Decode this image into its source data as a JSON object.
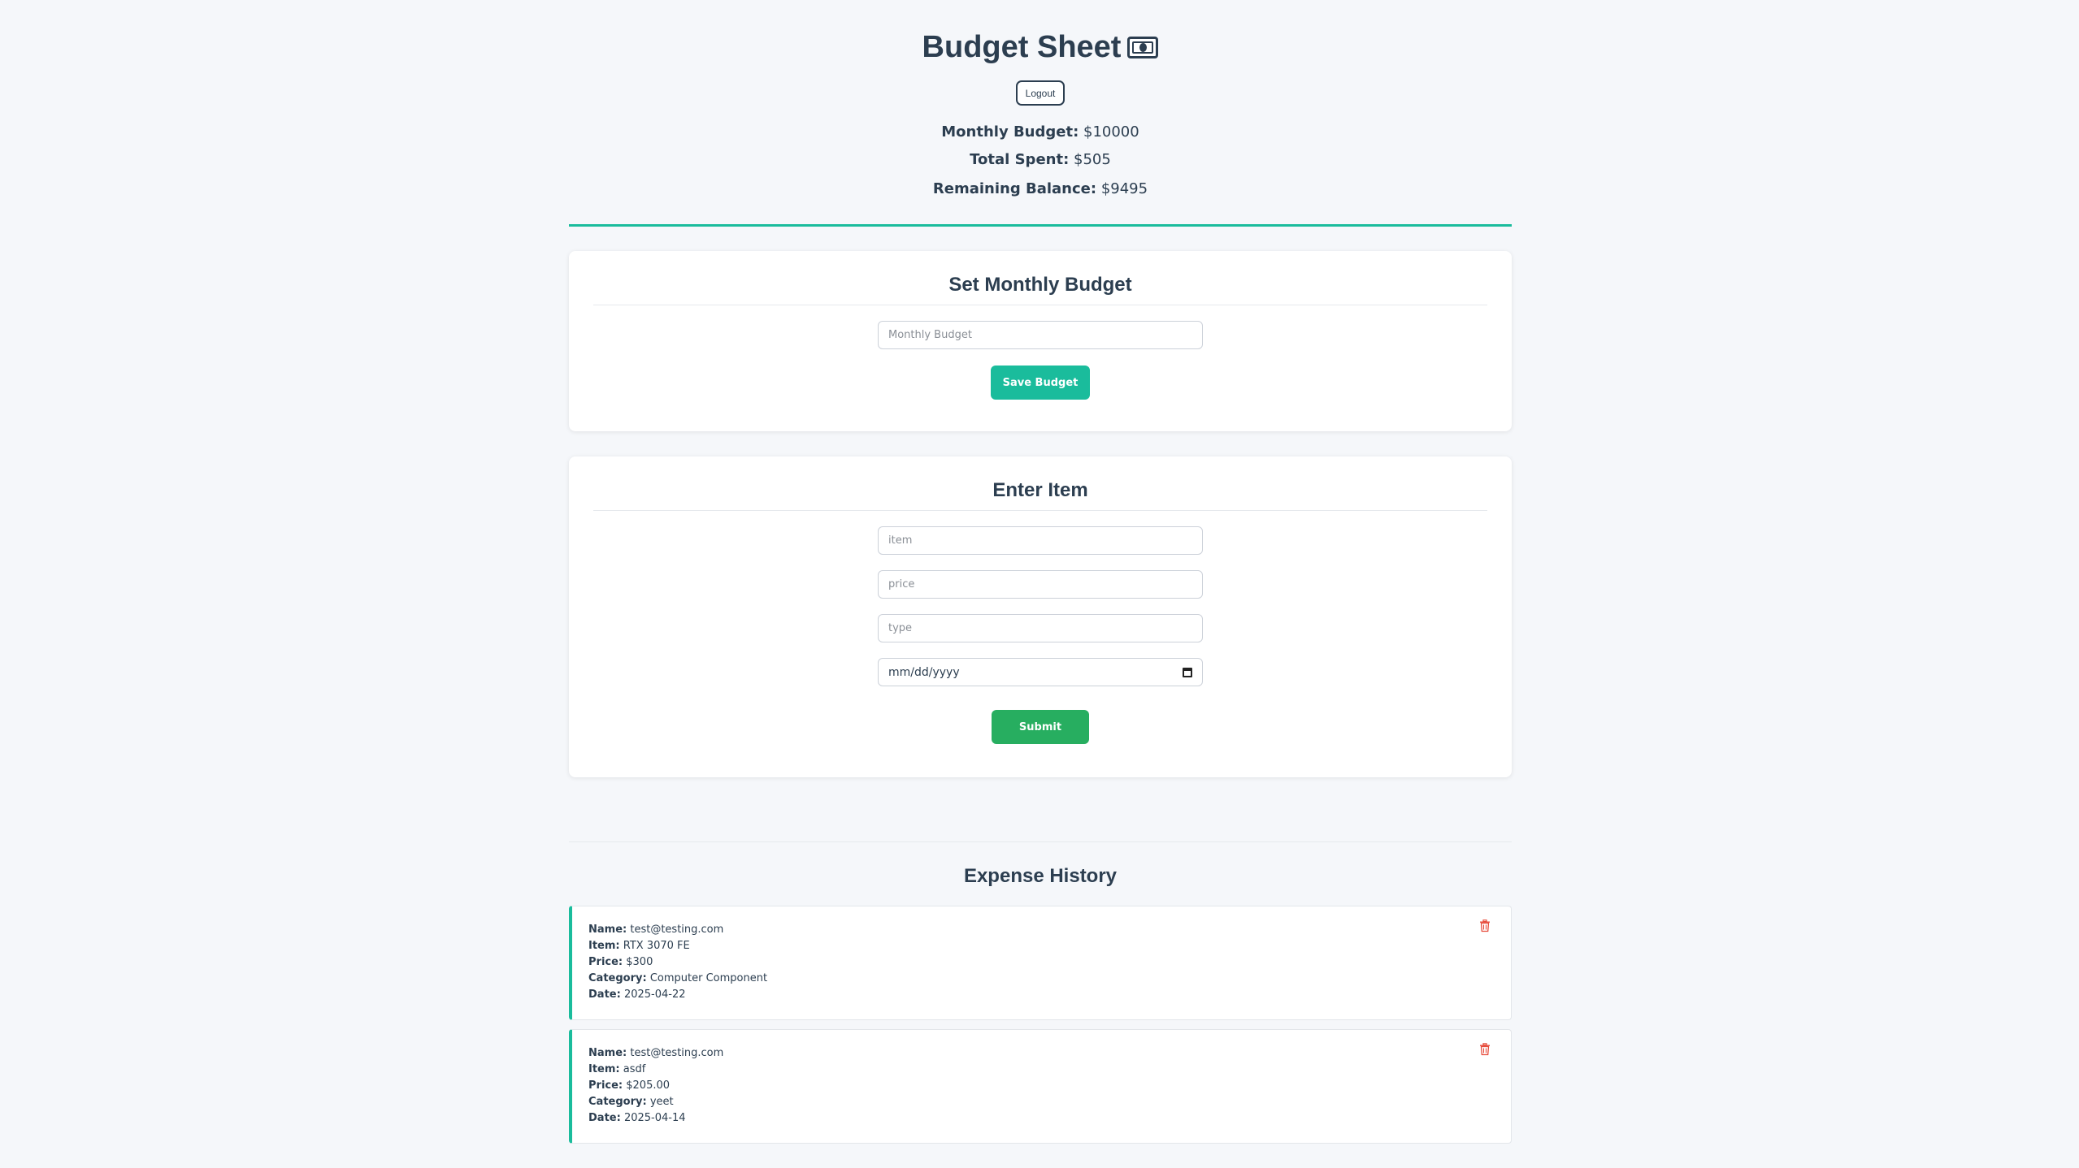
{
  "header": {
    "title": "Budget Sheet",
    "title_icon": "money-bill-icon",
    "logout_label": "Logout"
  },
  "summary": {
    "monthly_budget_label": "Monthly Budget:",
    "monthly_budget_value": "$10000",
    "total_spent_label": "Total Spent:",
    "total_spent_value": "$505",
    "remaining_label": "Remaining Balance:",
    "remaining_value": "$9495"
  },
  "budget_form": {
    "title": "Set Monthly Budget",
    "budget_placeholder": "Monthly Budget",
    "budget_value": "",
    "save_label": "Save Budget"
  },
  "item_form": {
    "title": "Enter Item",
    "item_placeholder": "item",
    "price_placeholder": "price",
    "type_placeholder": "type",
    "date_placeholder": "mm/dd/yyyy",
    "submit_label": "Submit"
  },
  "history": {
    "title": "Expense History",
    "labels": {
      "name": "Name:",
      "item": "Item:",
      "price": "Price:",
      "category": "Category:",
      "date": "Date:"
    },
    "entries": [
      {
        "name": "test@testing.com",
        "item": "RTX 3070 FE",
        "price": "$300",
        "category": "Computer Component",
        "date": "2025-04-22"
      },
      {
        "name": "test@testing.com",
        "item": "asdf",
        "price": "$205.00",
        "category": "yeet",
        "date": "2025-04-14"
      }
    ]
  },
  "colors": {
    "accent": "#1abc9c",
    "submit": "#27ae60",
    "delete": "#e74c3c",
    "text": "#2c3e50",
    "background": "#f5f7fa"
  }
}
